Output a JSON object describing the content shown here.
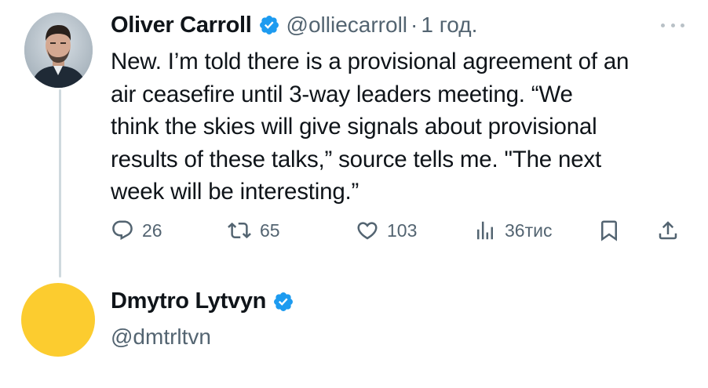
{
  "tweet": {
    "author": {
      "display_name": "Oliver Carroll",
      "handle": "@olliecarroll",
      "verified": true
    },
    "separator": "·",
    "time": "1 год.",
    "text_lines": [
      "New. I’m told there is a provisional agreement of an",
      "air ceasefire until 3-way leaders meeting. “We",
      "think the skies will give signals about provisional",
      "results of these talks,” source tells me. \"The next",
      "week will be interesting.”"
    ],
    "actions": {
      "replies": "26",
      "reposts": "65",
      "likes": "103",
      "views": "36тис"
    }
  },
  "next_user": {
    "display_name": "Dmytro Lytvyn",
    "handle": "@dmtrltvn",
    "verified": true
  },
  "icons": {
    "verified": "verified-badge-icon",
    "more": "more-horizontal-icon",
    "reply": "reply-icon",
    "repost": "repost-icon",
    "like": "heart-icon",
    "views": "views-chart-icon",
    "bookmark": "bookmark-icon",
    "share": "share-icon"
  },
  "colors": {
    "text": "#0f1419",
    "secondary": "#536471",
    "verified": "#1d9bf0",
    "thread_line": "#cfd9de",
    "avatar_yellow": "#fccc2f"
  }
}
